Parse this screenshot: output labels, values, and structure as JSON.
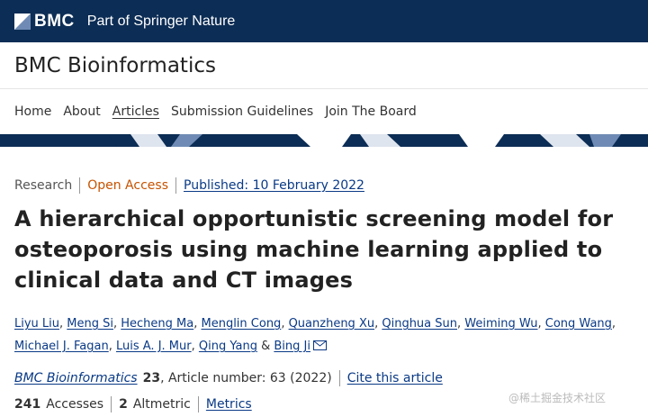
{
  "brand": {
    "logo_text": "BMC",
    "tagline": "Part of Springer Nature"
  },
  "journal": {
    "title": "BMC Bioinformatics"
  },
  "nav": {
    "items": [
      {
        "label": "Home"
      },
      {
        "label": "About"
      },
      {
        "label": "Articles"
      },
      {
        "label": "Submission Guidelines"
      },
      {
        "label": "Join The Board"
      }
    ]
  },
  "article": {
    "type": "Research",
    "access": "Open Access",
    "published": "Published: 10 February 2022",
    "title": "A hierarchical opportunistic screening model for osteoporosis using machine learning applied to clinical data and CT images",
    "authors": [
      "Liyu Liu",
      "Meng Si",
      "Hecheng Ma",
      "Menglin Cong",
      "Quanzheng Xu",
      "Qinghua Sun",
      "Weiming Wu",
      "Cong Wang",
      "Michael J. Fagan",
      "Luis A. J. Mur",
      "Qing Yang",
      "Bing Ji"
    ],
    "author_sep": ",",
    "author_last_sep": "&",
    "citation": {
      "journal": "BMC Bioinformatics",
      "volume": "23",
      "details": ", Article number: 63 (2022)",
      "cite_link": "Cite this article"
    },
    "metrics": {
      "accesses_count": "241",
      "accesses_label": "Accesses",
      "altmetric_count": "2",
      "altmetric_label": "Altmetric",
      "metrics_link": "Metrics"
    }
  },
  "watermark": "@稀土掘金技术社区",
  "colors": {
    "navy": "#0c2d55",
    "link": "#0a3a86",
    "open_access": "#c65301"
  }
}
